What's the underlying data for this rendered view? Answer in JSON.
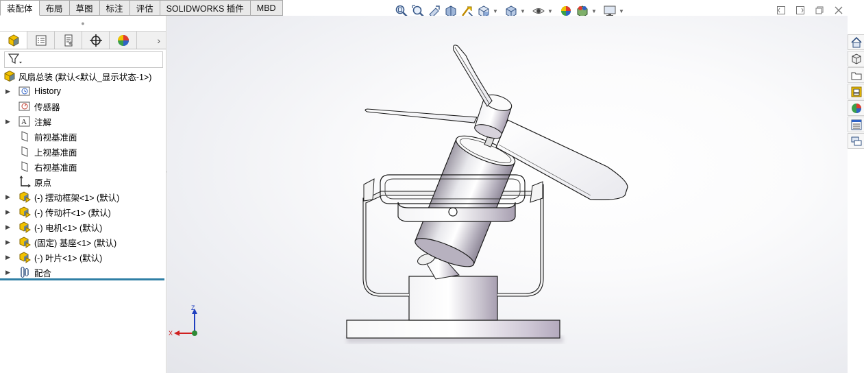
{
  "command_tabs": [
    "装配体",
    "布局",
    "草图",
    "标注",
    "评估",
    "SOLIDWORKS 插件",
    "MBD"
  ],
  "heads_up_toolbar": [
    {
      "icon": "zoom-to-fit-icon"
    },
    {
      "icon": "zoom-to-area-icon"
    },
    {
      "icon": "previous-view-icon"
    },
    {
      "icon": "section-view-icon"
    },
    {
      "icon": "dynamic-annotation-icon"
    },
    {
      "icon": "view-orientation-icon",
      "dropdown": true
    },
    {
      "icon": "display-style-icon",
      "dropdown": true
    },
    {
      "icon": "hide-show-items-icon",
      "dropdown": true
    },
    {
      "icon": "edit-appearance-icon"
    },
    {
      "icon": "apply-scene-icon",
      "dropdown": true
    },
    {
      "icon": "view-settings-icon",
      "dropdown": true
    }
  ],
  "window_controls": [
    "restore-panel-icon",
    "expand-icon",
    "restore-icon",
    "close-icon"
  ],
  "panel_tabs": [
    "featuremanager-tab-icon",
    "propertymanager-tab-icon",
    "configurationmanager-tab-icon",
    "dimxpert-tab-icon",
    "display-manager-tab-icon"
  ],
  "tree": {
    "root": "风扇总装  (默认<默认_显示状态-1>)",
    "items": [
      {
        "label": "History",
        "icon": "history-icon",
        "expandable": true
      },
      {
        "label": "传感器",
        "icon": "sensor-icon",
        "expandable": false
      },
      {
        "label": "注解",
        "icon": "annotation-icon",
        "expandable": true
      },
      {
        "label": "前视基准面",
        "icon": "plane-icon",
        "expandable": false
      },
      {
        "label": "上视基准面",
        "icon": "plane-icon",
        "expandable": false
      },
      {
        "label": "右视基准面",
        "icon": "plane-icon",
        "expandable": false
      },
      {
        "label": "原点",
        "icon": "origin-icon",
        "expandable": false
      },
      {
        "label": "(-) 摆动框架<1> (默认)",
        "icon": "part-icon",
        "expandable": true
      },
      {
        "label": "(-) 传动杆<1> (默认)",
        "icon": "part-icon",
        "expandable": true
      },
      {
        "label": "(-) 电机<1> (默认)",
        "icon": "part-icon",
        "expandable": true
      },
      {
        "label": "(固定) 基座<1> (默认)",
        "icon": "part-icon",
        "expandable": true
      },
      {
        "label": "(-) 叶片<1> (默认)",
        "icon": "part-icon",
        "expandable": true
      },
      {
        "label": "配合",
        "icon": "mates-icon",
        "expandable": true
      }
    ]
  },
  "task_pane": [
    "solidworks-resources-icon",
    "design-library-icon",
    "file-explorer-icon",
    "view-palette-icon",
    "appearances-icon",
    "custom-properties-icon",
    "forum-icon"
  ],
  "triad": {
    "z": "Z",
    "x": "X"
  },
  "colors": {
    "rollback_bar": "#2f7fa5",
    "part_icon": "#f2c200",
    "accent_blue": "#1f5fbf"
  }
}
